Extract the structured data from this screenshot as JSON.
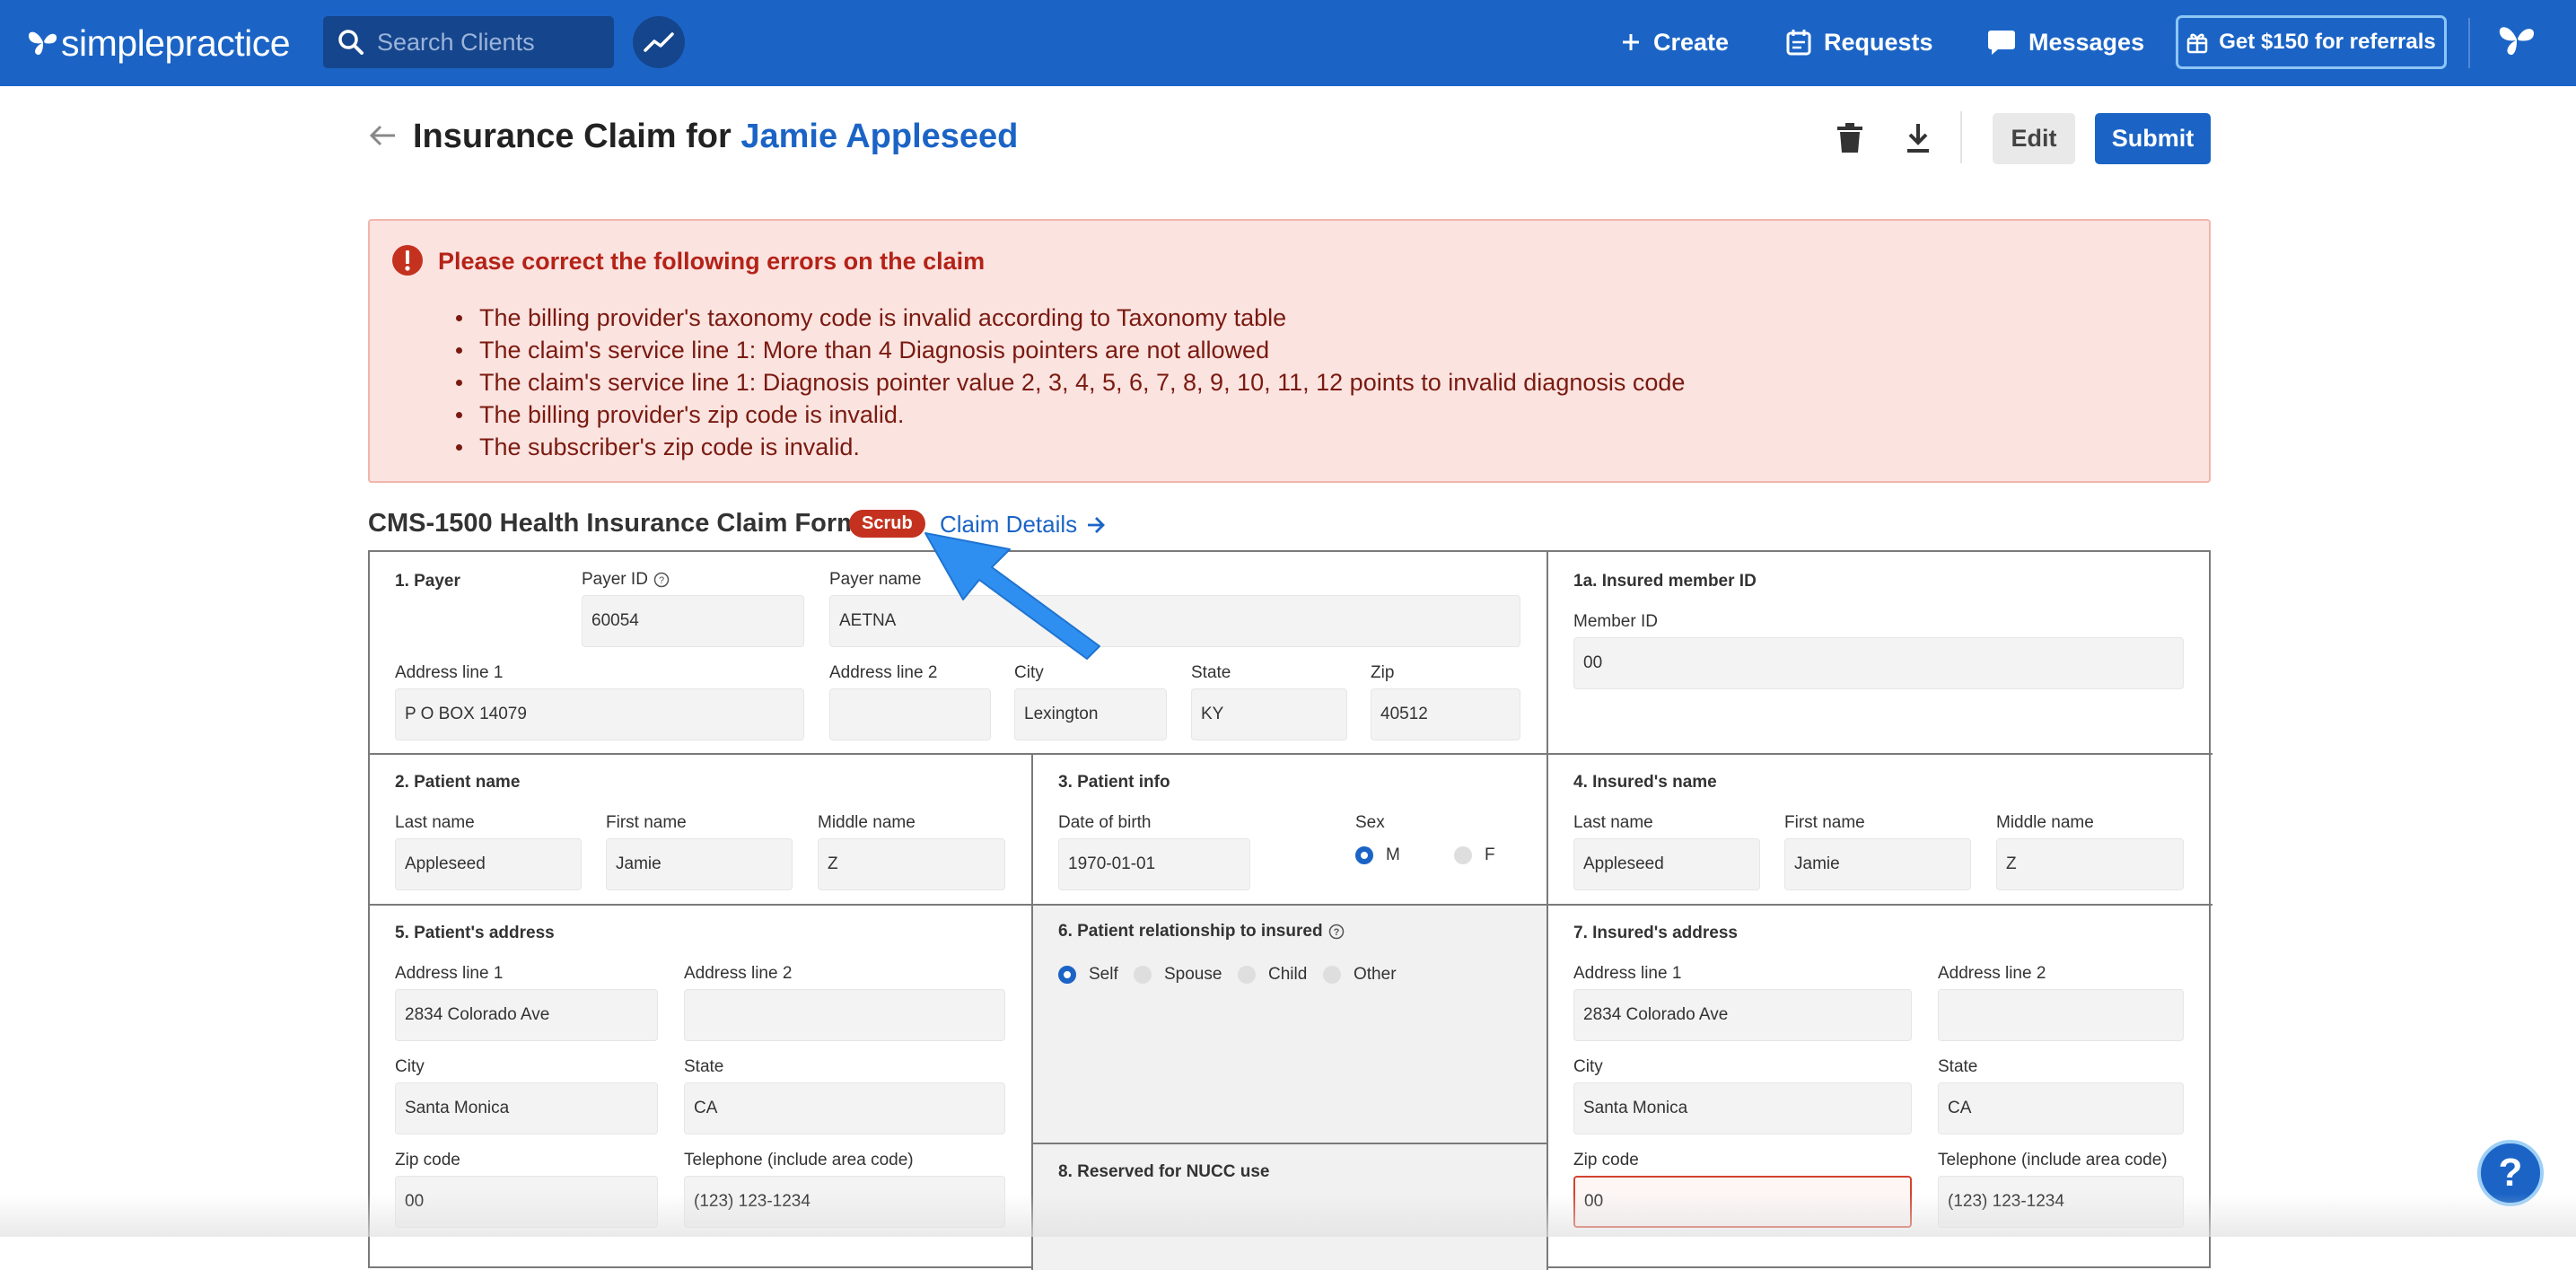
{
  "nav": {
    "logo_light": "simple",
    "logo_bold": "practice",
    "search_placeholder": "Search Clients",
    "create": "Create",
    "requests": "Requests",
    "messages": "Messages",
    "referral": "Get $150 for referrals"
  },
  "header": {
    "title_prefix": "Insurance Claim for",
    "client_name": "Jamie Appleseed",
    "edit": "Edit",
    "submit": "Submit"
  },
  "errors": {
    "heading": "Please correct the following errors on the claim",
    "items": [
      "The billing provider's taxonomy code is invalid according to Taxonomy table",
      "The claim's service line 1: More than 4 Diagnosis pointers are not allowed",
      "The claim's service line 1: Diagnosis pointer value 2, 3, 4, 5, 6, 7, 8, 9, 10, 11, 12 points to invalid diagnosis code",
      "The billing provider's zip code is invalid.",
      "The subscriber's zip code is invalid."
    ]
  },
  "form": {
    "title": "CMS-1500 Health Insurance Claim Form",
    "badge": "Scrub",
    "details_link": "Claim Details",
    "payer": {
      "section": "1. Payer",
      "payer_id_label": "Payer ID",
      "payer_id": "60054",
      "payer_name_label": "Payer name",
      "payer_name": "AETNA",
      "addr1_label": "Address line 1",
      "addr1": "P O BOX 14079",
      "addr2_label": "Address line 2",
      "addr2": "",
      "city_label": "City",
      "city": "Lexington",
      "state_label": "State",
      "state": "KY",
      "zip_label": "Zip",
      "zip": "40512"
    },
    "insured_id": {
      "section": "1a. Insured member ID",
      "member_id_label": "Member ID",
      "member_id": "00"
    },
    "patient_name": {
      "section": "2. Patient name",
      "last_label": "Last name",
      "last": "Appleseed",
      "first_label": "First name",
      "first": "Jamie",
      "middle_label": "Middle name",
      "middle": "Z"
    },
    "patient_info": {
      "section": "3. Patient info",
      "dob_label": "Date of birth",
      "dob": "1970-01-01",
      "sex_label": "Sex",
      "sex_m": "M",
      "sex_f": "F",
      "selected": "M"
    },
    "insured_name": {
      "section": "4. Insured's name",
      "last_label": "Last name",
      "last": "Appleseed",
      "first_label": "First name",
      "first": "Jamie",
      "middle_label": "Middle name",
      "middle": "Z"
    },
    "patient_address": {
      "section": "5. Patient's address",
      "addr1_label": "Address line 1",
      "addr1": "2834 Colorado Ave",
      "addr2_label": "Address line 2",
      "addr2": "",
      "city_label": "City",
      "city": "Santa Monica",
      "state_label": "State",
      "state": "CA",
      "zip_label": "Zip code",
      "zip": "00",
      "phone_label": "Telephone (include area code)",
      "phone": "(123) 123-1234"
    },
    "relationship": {
      "section": "6. Patient relationship to insured",
      "options": [
        "Self",
        "Spouse",
        "Child",
        "Other"
      ],
      "selected": "Self"
    },
    "insured_address": {
      "section": "7. Insured's address",
      "addr1_label": "Address line 1",
      "addr1": "2834 Colorado Ave",
      "addr2_label": "Address line 2",
      "addr2": "",
      "city_label": "City",
      "city": "Santa Monica",
      "state_label": "State",
      "state": "CA",
      "zip_label": "Zip code",
      "zip": "00",
      "phone_label": "Telephone (include area code)",
      "phone": "(123) 123-1234"
    },
    "reserved": {
      "section": "8. Reserved for NUCC use"
    }
  },
  "help": "?",
  "colors": {
    "brand": "#1b64c6",
    "error": "#c4321f",
    "error_bg": "#fbe3e0",
    "pointer_arrow": "#2f8ff0"
  }
}
